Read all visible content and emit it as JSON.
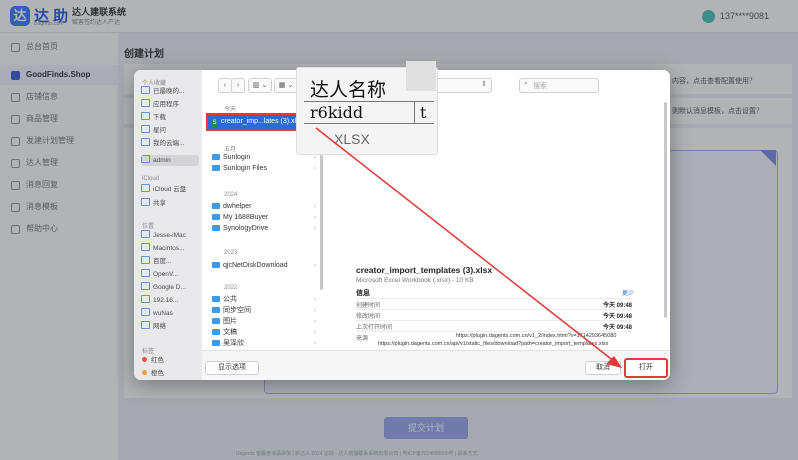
{
  "app": {
    "logo_char": "达",
    "logo_name": "达 助",
    "logo_sub": "Dagents.com",
    "system_name": "达人建联系统",
    "system_sub": "赋客签约达人产达",
    "phone": "137****9081"
  },
  "sidebar": {
    "items": [
      "总台首页",
      "GoodFinds.Shop",
      "店铺信息",
      "商品管理",
      "发建计划管理",
      "达人管理",
      "消息回复",
      "消息模板",
      "帮助中心"
    ]
  },
  "main": {
    "page_title": "创建计划",
    "hint1": "内容，点击查看配置使用？",
    "hint2": "则默认消息模板，点击设置？",
    "submit": "提交计划",
    "footer": "Dagents 客服咨询请添加 | 新达人 2024 达助 - 达人链接联系系统有限公司 | 粤ICP备2024000000号 | 联系方式"
  },
  "dialog": {
    "sidebar": {
      "favorites_head": "个人收藏",
      "favorites": [
        "已最晚的...",
        "应用程序",
        "下载",
        "星问",
        "我的云端...",
        "admin"
      ],
      "icloud_head": "iCloud",
      "icloud": [
        "iCloud 云盘",
        "共享"
      ],
      "locations_head": "位置",
      "locations": [
        "Jesse-iMac",
        "Macintos...",
        "百度...",
        "OpenV...",
        "Google D...",
        "192.16...",
        "wuNas",
        "网络"
      ],
      "tags_head": "标签",
      "tags": [
        {
          "name": "红色",
          "color": "#e8534a"
        },
        {
          "name": "橙色",
          "color": "#f0a33a"
        }
      ]
    },
    "toolbar": {
      "back": "‹",
      "forward": "›",
      "view_label": "▥ ⌄",
      "grid_label": "▦ ⌄",
      "path": "admin",
      "search_placeholder": "搜索"
    },
    "column": {
      "today_head": "今天",
      "selected_file": "creator_imp...lates (3).xlsx",
      "fivemonth_head": "五月",
      "may_items": [
        "Sunlogin",
        "Sunlogin Files"
      ],
      "y2024_head": "2024",
      "y2024_items": [
        "dwhelper",
        "My 1688Buyer",
        "SynologyDrive"
      ],
      "y2023_head": "2023",
      "y2023_items": [
        "qjcNetDiskDownload"
      ],
      "y2022_head": "2022",
      "y2022_items": [
        "公共",
        "同步空间",
        "图片",
        "文稿",
        "吴泽欣"
      ]
    },
    "preview": {
      "thumb_cell1": "达人名称",
      "thumb_cell2": "r6kidd",
      "thumb_cell3": "t",
      "thumb_label": "XLSX",
      "file_name": "creator_import_templates (3).xlsx",
      "file_kind": "Microsoft Excel Workbook (.xlsx) - 10 KB",
      "info_title": "信息",
      "info_more": "更少",
      "rows": [
        {
          "k": "创建时间",
          "v": "今天 09:48"
        },
        {
          "k": "修改时间",
          "v": "今天 09:48"
        },
        {
          "k": "上次打开时间",
          "v": "今天 09:48"
        }
      ],
      "source_key": "来源",
      "source_line1": "https://plugin.dagents.com.cn/v1_2/index.html?v=1714293645080",
      "source_line2": "https://plugin.dagents.com.cn/api/v1/static_files/download?path=creator_import_templates.xlsx"
    },
    "bottom": {
      "show_options": "显示选项",
      "cancel": "取消",
      "open": "打开"
    }
  },
  "colors": {
    "selection": "#2b6bd9",
    "annotation": "#e03a3a",
    "brand": "#3a7bfd"
  }
}
